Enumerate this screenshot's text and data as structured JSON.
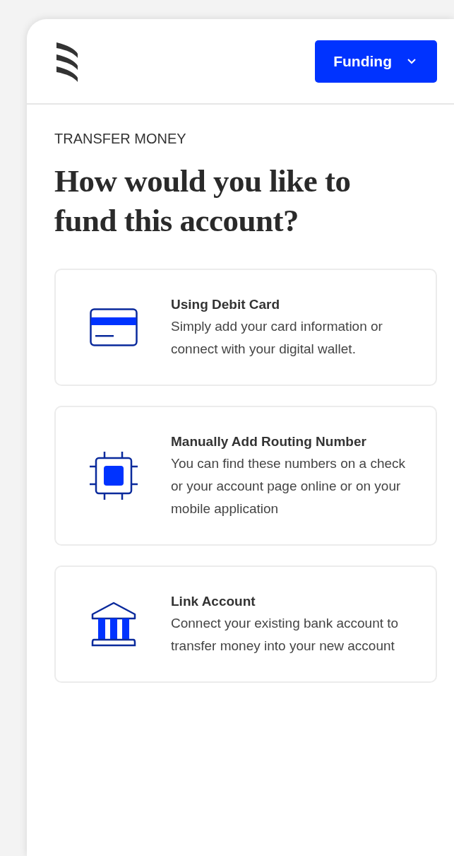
{
  "header": {
    "menu_button": "Funding"
  },
  "eyebrow": "TRANSFER MONEY",
  "title": "How would you like to fund this account?",
  "options": [
    {
      "kind": "card",
      "title": "Using Debit Card",
      "description": "Simply add your card information or connect with your digital wallet."
    },
    {
      "kind": "chip",
      "title": "Manually Add Routing Number",
      "description": "You can find these numbers on a check or your account page online or on your mobile application"
    },
    {
      "kind": "bank",
      "title": "Link Account",
      "description": "Connect your existing bank account to  transfer money into your new account"
    }
  ]
}
